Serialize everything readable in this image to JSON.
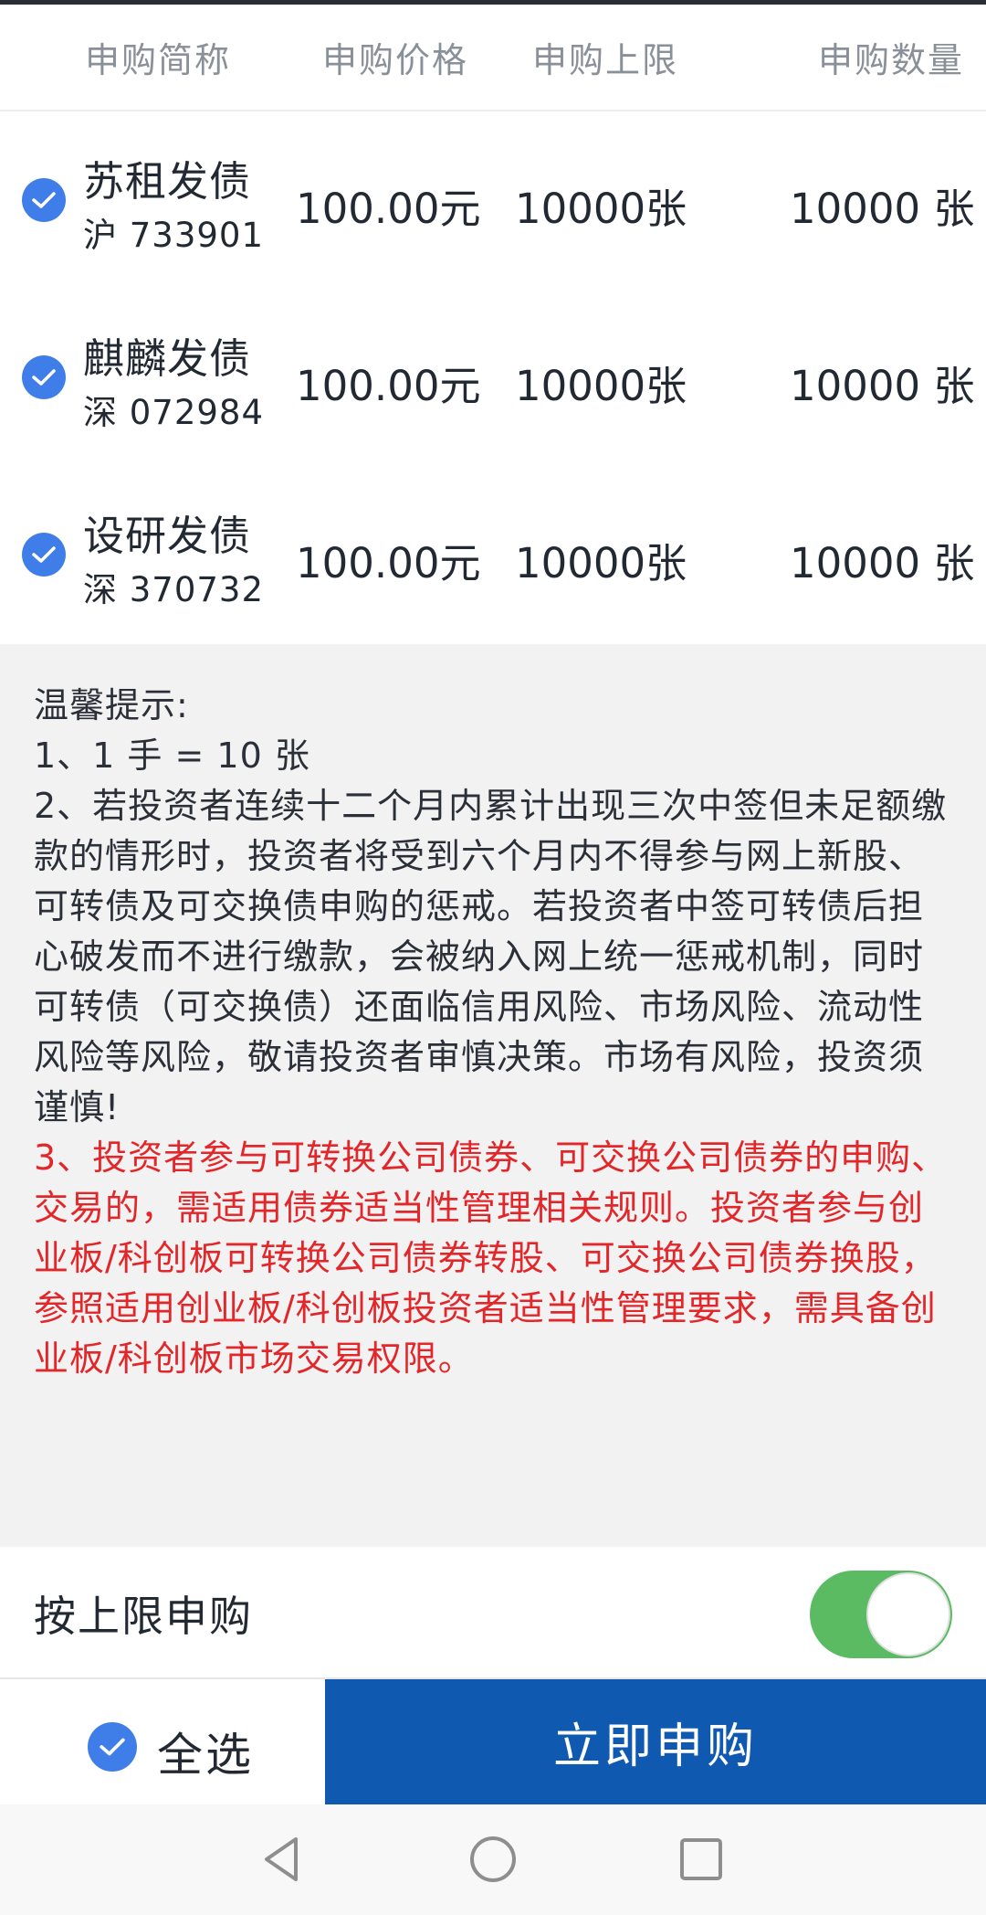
{
  "header": {
    "columns": [
      "申购简称",
      "申购价格",
      "申购上限",
      "申购数量"
    ]
  },
  "bonds": [
    {
      "name": "苏租发债",
      "code": "沪 733901",
      "price": "100.00元",
      "limit": "10000张",
      "quantity": "10000 张",
      "checked": true
    },
    {
      "name": "麒麟发债",
      "code": "深 072984",
      "price": "100.00元",
      "limit": "10000张",
      "quantity": "10000 张",
      "checked": true
    },
    {
      "name": "设研发债",
      "code": "深 370732",
      "price": "100.00元",
      "limit": "10000张",
      "quantity": "10000 张",
      "checked": true
    }
  ],
  "notice": {
    "title": "温馨提示:",
    "item1": "1、1 手 = 10 张",
    "item2": "2、若投资者连续十二个月内累计出现三次中签但未足额缴款的情形时，投资者将受到六个月内不得参与网上新股、可转债及可交换债申购的惩戒。若投资者中签可转债后担心破发而不进行缴款，会被纳入网上统一惩戒机制，同时可转债（可交换债）还面临信用风险、市场风险、流动性风险等风险，敬请投资者审慎决策。市场有风险，投资须谨慎!",
    "item3": "3、投资者参与可转换公司债券、可交换公司债券的申购、交易的，需适用债券适当性管理相关规则。投资者参与创业板/科创板可转换公司债券转股、可交换公司债券换股，参照适用创业板/科创板投资者适当性管理要求，需具备创业板/科创板市场交易权限。"
  },
  "toggle": {
    "label": "按上限申购",
    "on": true
  },
  "footer": {
    "select_all_label": "全选",
    "apply_label": "立即申购"
  },
  "colors": {
    "accent": "#0f5ab0",
    "check": "#3f7ee8",
    "toggle_on": "#5bbb62",
    "warning": "#e3262a"
  },
  "icons": {
    "check": "check-circle-icon",
    "back": "back-triangle-icon",
    "home": "home-circle-icon",
    "recents": "recents-square-icon"
  }
}
